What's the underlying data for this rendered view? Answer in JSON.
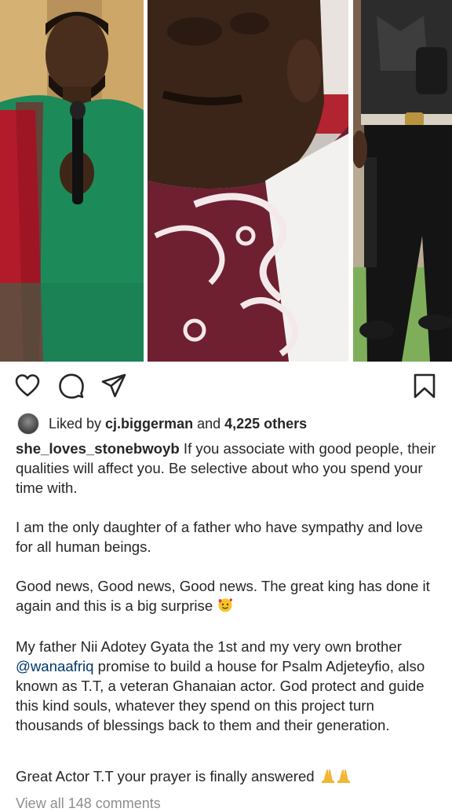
{
  "post": {
    "likes": {
      "prefix": "Liked by ",
      "liked_by_user": "cj.biggerman",
      "conj": " and ",
      "others_count": "4,225 others"
    },
    "caption": {
      "username": "she_loves_stonebwoyb",
      "p1": " If you associate with good people, their qualities will affect you. Be selective about who you spend your time with.",
      "p2": "I am the only daughter of a  father who have sympathy and love for all human beings.",
      "p3": "Good news, Good news, Good news. The great king has done it again and this is a big surprise",
      "p4_a": "My father Nii Adotey Gyata the 1st and my very own brother ",
      "p4_mention": "@wanaafriq",
      "p4_b": "  promise to build a house for Psalm Adjeteyfio, also known as T.T, a veteran Ghanaian actor. God protect and guide this kind souls, whatever they spend on this project turn thousands of blessings back to them and their generation.",
      "p5": "Great Actor T.T  your prayer is finally answered"
    },
    "comments_link": "View all 148 comments"
  },
  "icons": {
    "like": "heart-icon",
    "comment": "comment-icon",
    "share": "send-icon",
    "save": "bookmark-icon",
    "emoji1": "smiling-face-with-hearts-icon",
    "emoji2": "folded-hands-icon"
  },
  "colors": {
    "text": "#262626",
    "mention": "#00376b",
    "muted": "#8e8e8e"
  }
}
